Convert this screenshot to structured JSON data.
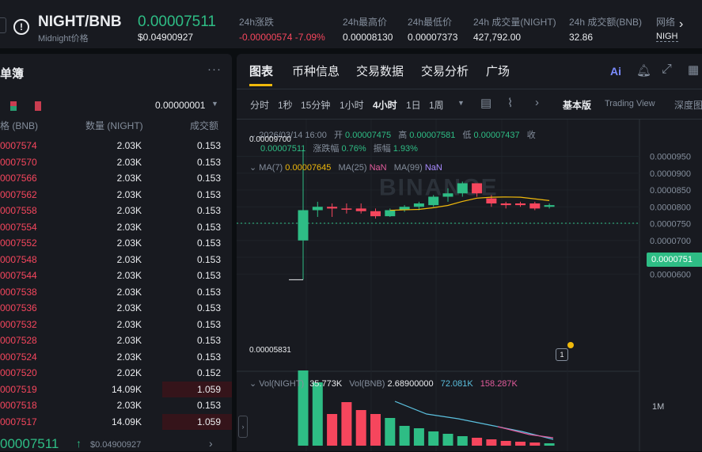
{
  "header": {
    "symbol": "NIGHT/BNB",
    "subtitle": "Midnight价格",
    "price": "0.00007511",
    "price_usd": "$0.04900927",
    "stats": [
      {
        "label": "24h涨跌",
        "value": "-0.00000574 -7.09%"
      },
      {
        "label": "24h最高价",
        "value": "0.00008130"
      },
      {
        "label": "24h最低价",
        "value": "0.00007373"
      },
      {
        "label": "24h 成交量(NIGHT)",
        "value": "427,792.00"
      },
      {
        "label": "24h 成交额(BNB)",
        "value": "32.86"
      },
      {
        "label": "网络",
        "value": "NIGH"
      }
    ]
  },
  "orderbook": {
    "title": "单簿",
    "precision": "0.00000001",
    "col_price": "格 (BNB)",
    "col_qty": "数量 (NIGHT)",
    "col_total": "成交额",
    "rows": [
      {
        "p": "0007574",
        "q": "2.03K",
        "t": "0.153"
      },
      {
        "p": "0007570",
        "q": "2.03K",
        "t": "0.153"
      },
      {
        "p": "0007566",
        "q": "2.03K",
        "t": "0.153"
      },
      {
        "p": "0007562",
        "q": "2.03K",
        "t": "0.153"
      },
      {
        "p": "0007558",
        "q": "2.03K",
        "t": "0.153"
      },
      {
        "p": "0007554",
        "q": "2.03K",
        "t": "0.153"
      },
      {
        "p": "0007552",
        "q": "2.03K",
        "t": "0.153"
      },
      {
        "p": "0007548",
        "q": "2.03K",
        "t": "0.153"
      },
      {
        "p": "0007544",
        "q": "2.03K",
        "t": "0.153"
      },
      {
        "p": "0007538",
        "q": "2.03K",
        "t": "0.153"
      },
      {
        "p": "0007536",
        "q": "2.03K",
        "t": "0.153"
      },
      {
        "p": "0007532",
        "q": "2.03K",
        "t": "0.153"
      },
      {
        "p": "0007528",
        "q": "2.03K",
        "t": "0.153"
      },
      {
        "p": "0007524",
        "q": "2.03K",
        "t": "0.153"
      },
      {
        "p": "0007520",
        "q": "2.02K",
        "t": "0.152"
      },
      {
        "p": "0007519",
        "q": "14.09K",
        "t": "1.059"
      },
      {
        "p": "0007518",
        "q": "2.03K",
        "t": "0.153"
      },
      {
        "p": "0007517",
        "q": "14.09K",
        "t": "1.059"
      }
    ],
    "last_price": "00007511",
    "last_usd": "$0.04900927"
  },
  "tabs": [
    "图表",
    "币种信息",
    "交易数据",
    "交易分析",
    "广场"
  ],
  "timeframes": [
    "分时",
    "1秒",
    "15分钟",
    "1小时",
    "4小时",
    "1日",
    "1周"
  ],
  "views": [
    "基本版",
    "Trading View",
    "深度图"
  ],
  "ohlc": {
    "date": "2026/03/14 16:00",
    "open_label": "开",
    "open": "0.00007475",
    "high_label": "高",
    "high": "0.00007581",
    "low_label": "低",
    "low": "0.00007437",
    "close_label": "收",
    "close": "0.00007511",
    "chg_label": "涨跌幅",
    "chg": "0.76%",
    "amp_label": "振幅",
    "amp": "1.93%"
  },
  "ma": {
    "ma7_label": "MA(7)",
    "ma7": "0.00007645",
    "ma25_label": "MA(25)",
    "ma25": "NaN",
    "ma99_label": "MA(99)",
    "ma99": "NaN"
  },
  "vol": {
    "label1": "Vol(NIGHT)",
    "v1": "35.773K",
    "label2": "Vol(BNB)",
    "v2": "2.68900000",
    "v3": "72.081K",
    "v4": "158.287K",
    "axis": "1M"
  },
  "price_axis": [
    "0.0000950",
    "0.0000900",
    "0.0000850",
    "0.0000800",
    "0.0000750",
    "0.0000700",
    "0.0000650",
    "0.0000600"
  ],
  "current_price_tag": "0.0000751",
  "max_label": "0.00009700",
  "min_label": "0.00005831",
  "watermark": "BINANCE",
  "colors": {
    "up": "#2ebd85",
    "down": "#f6465d",
    "ma7": "#f0b90b",
    "accent": "#f0b90b"
  },
  "candles": [
    {
      "o": 7000,
      "c": 7900,
      "h": 9700,
      "l": 5831
    },
    {
      "o": 7900,
      "c": 8000,
      "h": 8150,
      "l": 7700
    },
    {
      "o": 8000,
      "c": 7950,
      "h": 8100,
      "l": 7700
    },
    {
      "o": 7950,
      "c": 7930,
      "h": 8100,
      "l": 7800
    },
    {
      "o": 7950,
      "c": 7870,
      "h": 8100,
      "l": 7800
    },
    {
      "o": 7870,
      "c": 7720,
      "h": 7950,
      "l": 7650
    },
    {
      "o": 7720,
      "c": 7900,
      "h": 7950,
      "l": 7700
    },
    {
      "o": 7900,
      "c": 8000,
      "h": 8050,
      "l": 7850
    },
    {
      "o": 8000,
      "c": 8100,
      "h": 8150,
      "l": 7900
    },
    {
      "o": 8050,
      "c": 8300,
      "h": 8350,
      "l": 8000
    },
    {
      "o": 8300,
      "c": 8400,
      "h": 8550,
      "l": 8150
    },
    {
      "o": 8400,
      "c": 8700,
      "h": 8750,
      "l": 8300
    },
    {
      "o": 8700,
      "c": 8400,
      "h": 8700,
      "l": 8300
    },
    {
      "o": 8250,
      "c": 8100,
      "h": 8350,
      "l": 8000
    },
    {
      "o": 8100,
      "c": 8050,
      "h": 8150,
      "l": 7950
    },
    {
      "o": 8100,
      "c": 8050,
      "h": 8150,
      "l": 8000
    },
    {
      "o": 8100,
      "c": 7950,
      "h": 8150,
      "l": 7900
    },
    {
      "o": 8000,
      "c": 8050,
      "h": 8100,
      "l": 7950
    }
  ],
  "volumes": [
    95,
    80,
    40,
    55,
    45,
    40,
    35,
    25,
    22,
    18,
    15,
    12,
    10,
    8,
    6,
    5,
    4,
    3
  ]
}
